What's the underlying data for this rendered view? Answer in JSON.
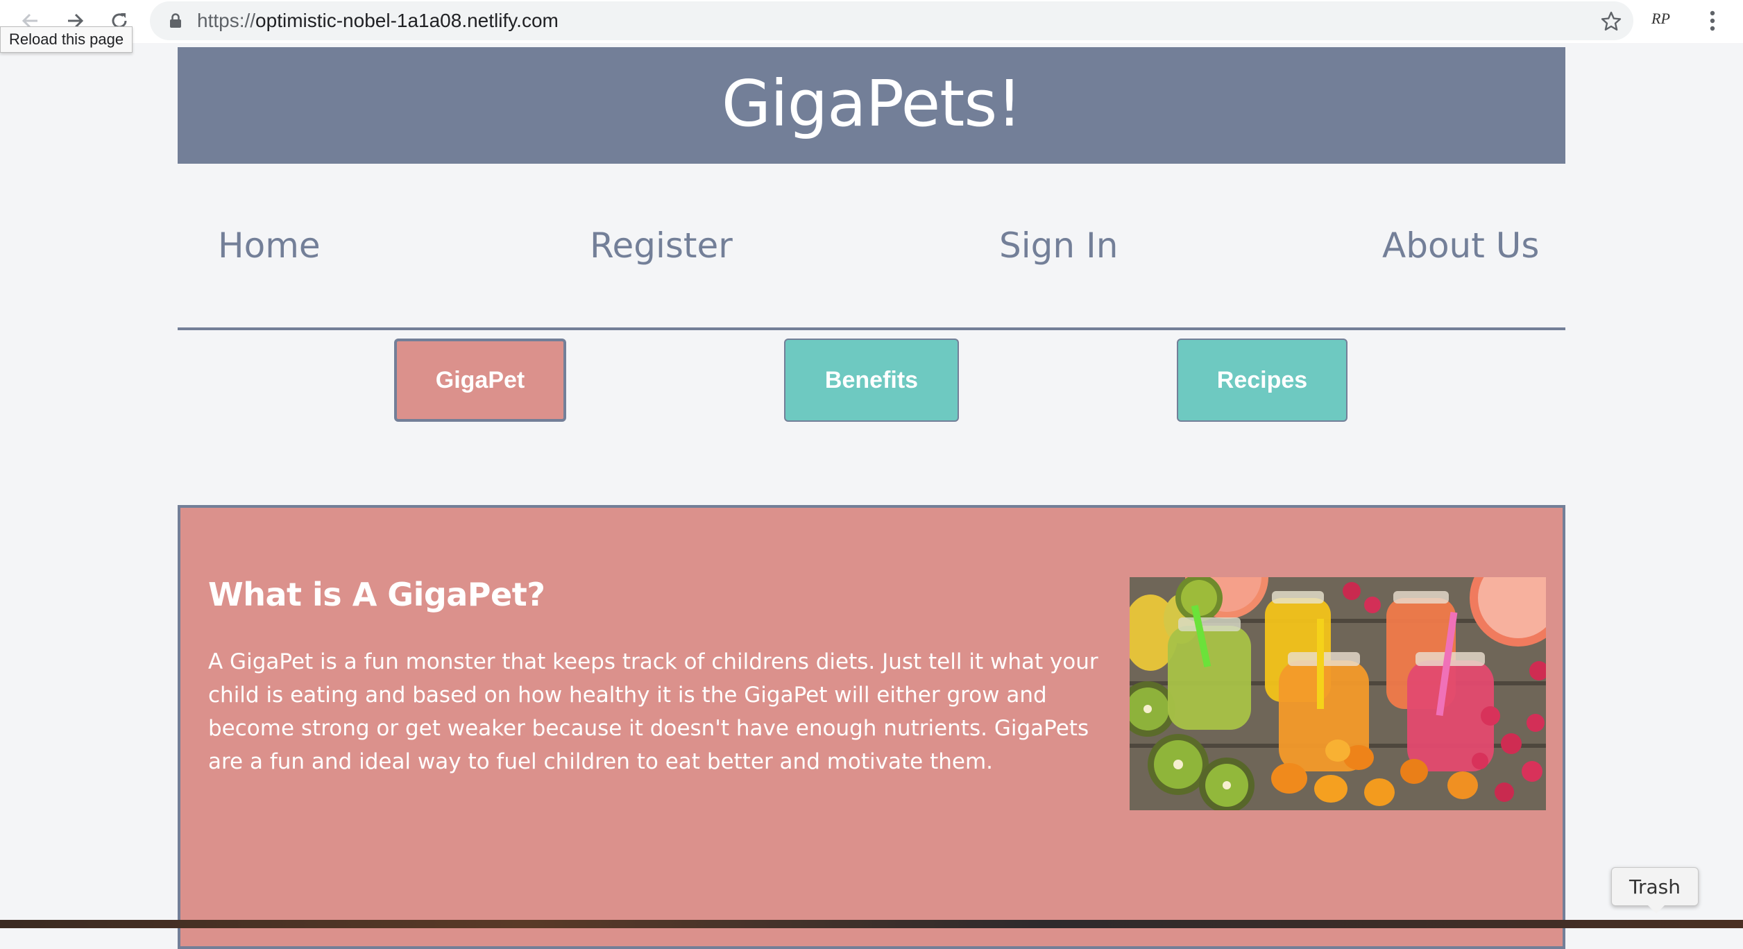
{
  "browser": {
    "url_scheme": "https://",
    "url_host": "optimistic-nobel-1a1a08.netlify.com",
    "tooltip": "Reload this page",
    "profile_initials": "RP"
  },
  "site": {
    "title": "GigaPets!",
    "nav": [
      "Home",
      "Register",
      "Sign In",
      "About Us"
    ],
    "tabs": [
      {
        "label": "GigaPet",
        "active": true
      },
      {
        "label": "Benefits",
        "active": false
      },
      {
        "label": "Recipes",
        "active": false
      }
    ]
  },
  "panel": {
    "heading": "What is A GigaPet?",
    "body": "A GigaPet is a fun monster that keeps track of childrens diets. Just tell it what your child is eating and based on how healthy it is the GigaPet will either grow and become strong or get weaker because it doesn't have enough nutrients. GigaPets are a fun and ideal way to fuel children to eat better and motivate them."
  },
  "dock": {
    "tooltip": "Trash"
  },
  "colors": {
    "header_bg": "#737f98",
    "accent_pink": "#db918c",
    "accent_teal": "#6ec9c1",
    "page_bg": "#f4f5f7"
  }
}
